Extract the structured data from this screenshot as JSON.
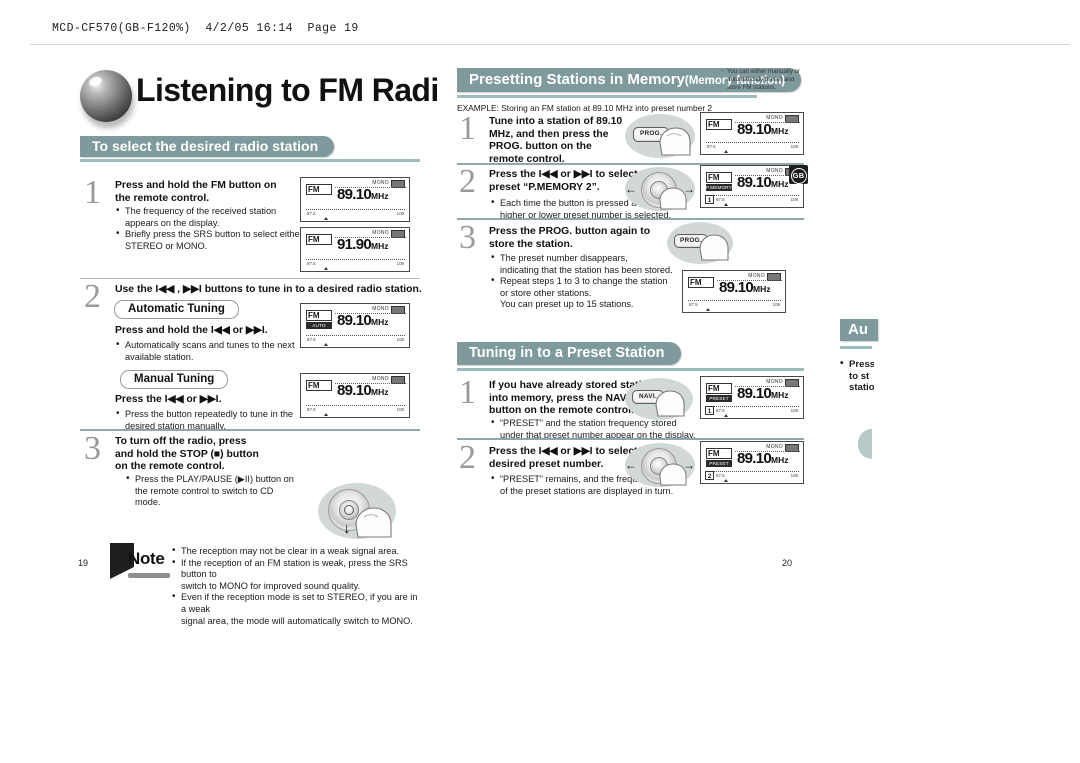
{
  "print_header": "MCD-CF570(GB-F120%)  4/2/05 16:14  Page 19",
  "left_page": {
    "title": "Listening to FM Radio",
    "section_banner": "To select the desired radio station",
    "page_number": "19",
    "steps": [
      {
        "num": "1",
        "heading": "Press and hold the FM button on\nthe remote control.",
        "bullets": [
          "The frequency of the received station",
          "appears on the display.",
          "Briefly press the SRS button to select either",
          "STEREO or MONO."
        ],
        "bullet_flags": [
          true,
          false,
          true,
          false
        ]
      },
      {
        "num": "2",
        "heading": "Use the I◀◀ , ▶▶I buttons to tune in to a desired radio station.",
        "pill_auto": "Automatic Tuning",
        "auto_sub": "Press and hold the I◀◀ or ▶▶I.",
        "auto_bullets": [
          "Automatically scans and tunes to the next",
          "available station."
        ],
        "auto_flags": [
          true,
          false
        ],
        "pill_manual": "Manual Tuning",
        "manual_sub": "Press the I◀◀ or ▶▶I.",
        "manual_bullets": [
          "Press the button repeatedly to tune in the",
          "desired station manually."
        ],
        "manual_flags": [
          true,
          false
        ]
      },
      {
        "num": "3",
        "heading": "To turn off the radio, press\nand hold the STOP (■) button\non the remote control.",
        "bullets": [
          "Press the PLAY/PAUSE (▶II) button on",
          "the remote control to switch to CD",
          "mode."
        ],
        "bullet_flags": [
          true,
          false,
          false
        ]
      }
    ],
    "note": {
      "label": "Note",
      "lines": [
        "The reception may not be clear in a weak signal area.",
        "If the reception of an FM station is weak, press the SRS button to",
        "switch to MONO for improved sound quality.",
        "Even if the reception mode is set to STEREO, if you are in a weak",
        "signal area, the mode will automatically switch to MONO."
      ],
      "flags": [
        true,
        true,
        false,
        true,
        false
      ]
    },
    "displays": [
      {
        "freq": "89.10",
        "unit": "MHz",
        "mono": "MONO",
        "fm": "FM",
        "tag": "",
        "preset": "",
        "scale_left": "87.5",
        "scale_right": "108"
      },
      {
        "freq": "91.90",
        "unit": "MHz",
        "mono": "MONO",
        "fm": "FM",
        "tag": "",
        "preset": "",
        "scale_left": "87.5",
        "scale_right": "108"
      },
      {
        "freq": "89.10",
        "unit": "MHz",
        "mono": "MONO",
        "fm": "FM",
        "tag": "AUTO SCAN",
        "preset": "",
        "scale_left": "87.5",
        "scale_right": "108"
      },
      {
        "freq": "89.10",
        "unit": "MHz",
        "mono": "MONO",
        "fm": "FM",
        "tag": "",
        "preset": "",
        "scale_left": "87.5",
        "scale_right": "108"
      }
    ]
  },
  "middle_page": {
    "banner_main": "Presetting Stations in Memory",
    "banner_sub": "(Memory function)",
    "callout": [
      "You can either manually or",
      "automatically preset and",
      "store FM stations."
    ],
    "example": "EXAMPLE: Storing an FM station at 89.10 MHz into preset number 2",
    "page_number": "20",
    "badge": "GB",
    "steps": [
      {
        "num": "1",
        "heading": "Tune into a station of 89.10\nMHz, and then press the\nPROG. button on the\nremote control.",
        "bullets": [],
        "flags": [],
        "button_label": "PROG."
      },
      {
        "num": "2",
        "heading": "Press the I◀◀ or ▶▶I to select the\npreset “P.MEMORY 2”.",
        "bullets": [
          "Each time the button is pressed a",
          "higher or lower preset number is selected."
        ],
        "flags": [
          true,
          false
        ]
      },
      {
        "num": "3",
        "heading": "Press the PROG. button again to\nstore the station.",
        "bullets": [
          "The preset number disappears,",
          "indicating that the station has been stored.",
          "Repeat steps 1 to 3 to change the station",
          "or store other stations.",
          "You can preset up to 15 stations."
        ],
        "flags": [
          true,
          false,
          true,
          false,
          false
        ],
        "button_label": "PROG."
      }
    ],
    "preset_section": {
      "banner": "Tuning in to a Preset Station",
      "steps": [
        {
          "num": "1",
          "heading": "If you have already stored stations\ninto memory, press the NAVI.\nbutton on the remote control.",
          "bullets": [
            "“PRESET” and the station frequency stored",
            "under that preset number appear on the display."
          ],
          "flags": [
            true,
            false
          ],
          "button_label": "NAVI."
        },
        {
          "num": "2",
          "heading": "Press the I◀◀ or ▶▶I to select the\ndesired preset number.",
          "bullets": [
            "“PRESET” remains, and the frequencies",
            "of the preset stations are displayed in turn."
          ],
          "flags": [
            true,
            false
          ]
        }
      ]
    },
    "displays": [
      {
        "freq": "89.10",
        "unit": "MHz",
        "mono": "MONO",
        "fm": "FM",
        "tag": "",
        "preset": "",
        "scale_left": "87.5",
        "scale_right": "108"
      },
      {
        "freq": "89.10",
        "unit": "MHz",
        "mono": "MONO",
        "fm": "FM",
        "tag": "P.MEMORY",
        "preset": "1",
        "scale_left": "87.5",
        "scale_right": "108"
      },
      {
        "freq": "89.10",
        "unit": "MHz",
        "mono": "MONO",
        "fm": "FM",
        "tag": "",
        "preset": "",
        "scale_left": "87.5",
        "scale_right": "108"
      },
      {
        "freq": "89.10",
        "unit": "MHz",
        "mono": "MONO",
        "fm": "FM",
        "tag": "PRESET",
        "preset": "1",
        "scale_left": "87.5",
        "scale_right": "108"
      },
      {
        "freq": "89.10",
        "unit": "MHz",
        "mono": "MONO",
        "fm": "FM",
        "tag": "PRESET",
        "preset": "2",
        "scale_left": "87.5",
        "scale_right": "108"
      }
    ]
  },
  "right_page": {
    "banner_partial": "Au",
    "bullet_lines": [
      "Press",
      "to st",
      "statio"
    ]
  },
  "colors": {
    "banner": "#7f9a9c",
    "banner_underline": "#9fbcbd",
    "illustration": "#d2d7d8",
    "step_number": "#9a9a9a"
  }
}
